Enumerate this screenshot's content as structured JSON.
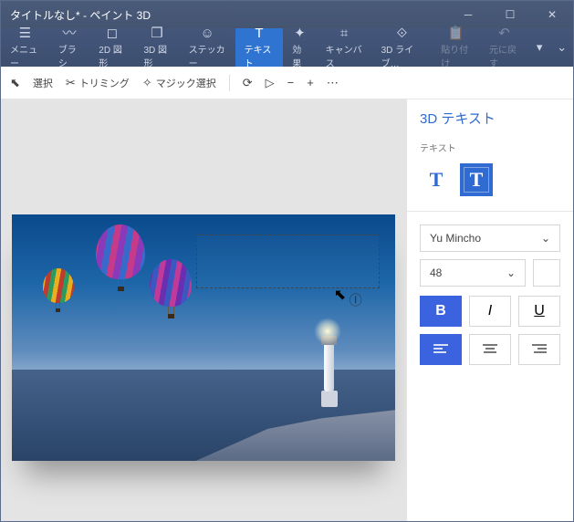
{
  "window": {
    "title": "タイトルなし* - ペイント 3D"
  },
  "ribbon": {
    "menu": "メニュー",
    "brush": "ブラシ",
    "shapes2d": "2D 図形",
    "shapes3d": "3D 図形",
    "sticker": "ステッカー",
    "text": "テキスト",
    "effects": "効果",
    "canvas": "キャンバス",
    "library3d": "3D ライブ…",
    "paste": "貼り付け",
    "undo": "元に戻す"
  },
  "toolbar": {
    "select": "選択",
    "trim": "トリミング",
    "magic": "マジック選択"
  },
  "side": {
    "header": "3D テキスト",
    "text_label": "テキスト",
    "font": "Yu Mincho",
    "size": "48",
    "bold": "B",
    "italic": "I",
    "underline": "U"
  }
}
